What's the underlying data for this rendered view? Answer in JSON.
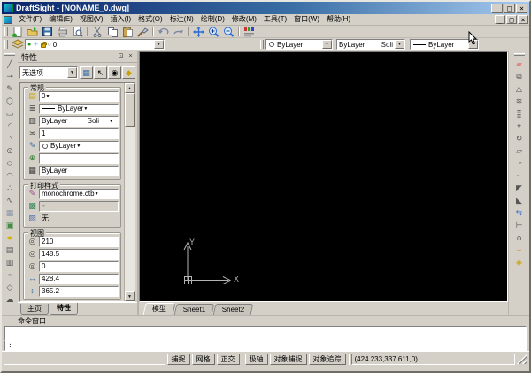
{
  "window": {
    "title": "DraftSight - [NONAME_0.dwg]"
  },
  "titlebar_buttons": {
    "minimize": "_",
    "maximize": "□",
    "close": "×"
  },
  "menu": {
    "items": [
      "文件(F)",
      "编辑(E)",
      "视图(V)",
      "插入(I)",
      "格式(O)",
      "标注(N)",
      "绘制(D)",
      "修改(M)",
      "工具(T)",
      "窗口(W)",
      "帮助(H)"
    ]
  },
  "toolbars": {
    "standard_icons": [
      "new",
      "open",
      "save",
      "print",
      "print-preview",
      "cut",
      "copy",
      "paste",
      "format-painter",
      "undo",
      "redo",
      "pan",
      "zoom-in",
      "zoom-out",
      "entity-colors"
    ],
    "layer": {
      "value": "0",
      "swatch_circle": "○",
      "on_dot": "●",
      "thaw_sun": "☀"
    },
    "line_color": {
      "value": "ByLayer"
    },
    "line_style": {
      "value": "ByLayer",
      "preview": "Soli"
    },
    "line_weight": {
      "value": "ByLayer"
    },
    "arrow_down": "▼"
  },
  "left_toolbar": {
    "icons": [
      {
        "name": "line",
        "glyph": "╱"
      },
      {
        "name": "construction-line",
        "glyph": "⊸"
      },
      {
        "name": "polyline",
        "glyph": "✎"
      },
      {
        "name": "polygon",
        "glyph": "⬡"
      },
      {
        "name": "rectangle",
        "glyph": "▭"
      },
      {
        "name": "arc-3point",
        "glyph": "◜"
      },
      {
        "name": "arc-center",
        "glyph": "◝"
      },
      {
        "name": "circle",
        "glyph": "⊙"
      },
      {
        "name": "ellipse",
        "glyph": "○"
      },
      {
        "name": "ellipse-arc",
        "glyph": "◠"
      },
      {
        "name": "point",
        "glyph": "∴"
      },
      {
        "name": "spline",
        "glyph": "∿"
      },
      {
        "name": "hatch",
        "glyph": "▦"
      },
      {
        "name": "region",
        "glyph": "▣"
      },
      {
        "name": "solid",
        "glyph": "●"
      },
      {
        "name": "block",
        "glyph": "▤"
      },
      {
        "name": "image",
        "glyph": "▥"
      },
      {
        "name": "boundary",
        "glyph": "▫"
      },
      {
        "name": "polygon-edit",
        "glyph": "◇"
      },
      {
        "name": "revision-cloud",
        "glyph": "☁"
      }
    ]
  },
  "right_toolbar": {
    "icons": [
      {
        "name": "erase",
        "glyph": "▰"
      },
      {
        "name": "copy-entity",
        "glyph": "⧉"
      },
      {
        "name": "mirror",
        "glyph": "△"
      },
      {
        "name": "offset",
        "glyph": "≋"
      },
      {
        "name": "pattern",
        "glyph": "⣿"
      },
      {
        "name": "move",
        "glyph": "⌖"
      },
      {
        "name": "rotate",
        "glyph": "↻"
      },
      {
        "name": "scale",
        "glyph": "▱"
      },
      {
        "name": "fillet",
        "glyph": "╭"
      },
      {
        "name": "fillet-2",
        "glyph": "╮"
      },
      {
        "name": "chamfer",
        "glyph": "◤"
      },
      {
        "name": "chamfer-2",
        "glyph": "◣"
      },
      {
        "name": "trim",
        "glyph": "⇆"
      },
      {
        "name": "extend",
        "glyph": "⊢"
      },
      {
        "name": "split",
        "glyph": "⋔"
      },
      {
        "name": "weld",
        "glyph": "⌣"
      },
      {
        "name": "explode",
        "glyph": "◈"
      }
    ]
  },
  "properties": {
    "title": "特性",
    "pin_glyph": "⊡",
    "close_glyph": "×",
    "no_selection": "无选项",
    "selector_buttons": [
      {
        "name": "select-matching",
        "glyph": "▦"
      },
      {
        "name": "select-entities",
        "glyph": "↖"
      },
      {
        "name": "quick-select",
        "glyph": "◉"
      },
      {
        "name": "property-painter",
        "glyph": "◆"
      }
    ],
    "general": {
      "label": "常规",
      "layer_icon": "▤",
      "layer": "0",
      "lineweight_icon": "≣",
      "lineweight": "ByLayer",
      "linestyle_icon": "▥",
      "linestyle": "ByLayer",
      "linestyle_preview": "Soli",
      "linescale_icon": "≍",
      "linescale": "1",
      "linecolor_icon": "✎",
      "linecolor": "ByLayer",
      "swatch_circle": "○",
      "hyperlink_icon": "⊕",
      "hyperlink": "",
      "transparency_icon": "▦",
      "transparency": "ByLayer"
    },
    "print_style": {
      "label": "打印样式",
      "style_icon": "✎",
      "style": "monochrome.ctb",
      "table_icon": "▩",
      "table": "",
      "none_icon": "▧",
      "none": "无"
    },
    "view": {
      "label": "视图",
      "cx_icon": "◎",
      "center_x": "210",
      "cy_icon": "◎",
      "center_y": "148.5",
      "cz_icon": "◎",
      "center_z": "0",
      "w_icon": "↔",
      "width": "428.4",
      "h_icon": "↕",
      "height": "365.2"
    },
    "tabs": [
      {
        "label": "主页"
      },
      {
        "label": "特性"
      }
    ],
    "scroll": {
      "up": "▲",
      "down": "▼"
    }
  },
  "drawing": {
    "axis_x": "X",
    "axis_y": "Y"
  },
  "sheet_tabs": [
    {
      "label": "模型"
    },
    {
      "label": "Sheet1"
    },
    {
      "label": "Sheet2"
    }
  ],
  "command": {
    "title": "命令窗口",
    "prompt": ":"
  },
  "status": {
    "buttons_left": [
      {
        "label": "捕捉"
      },
      {
        "label": "网格"
      },
      {
        "label": "正交"
      }
    ],
    "buttons_right": [
      {
        "label": "极轴"
      },
      {
        "label": "对象捕捉"
      },
      {
        "label": "对象追踪"
      }
    ],
    "coords": "(424.233,337.611,0)"
  },
  "colors": {
    "titlebar_start": "#0a246a",
    "titlebar_end": "#a6caf0",
    "chrome": "#d4d0c8",
    "canvas": "#000000",
    "accent_blue": "#3a6ea5"
  }
}
